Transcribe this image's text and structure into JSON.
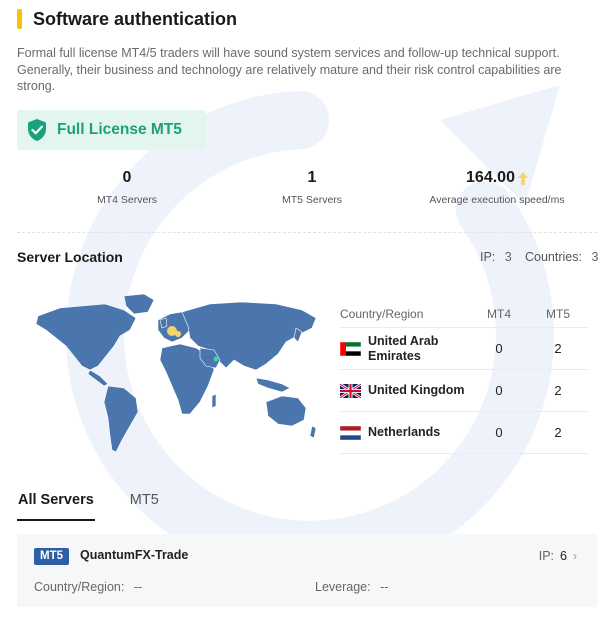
{
  "header": {
    "title": "Software authentication"
  },
  "description": "Formal full license MT4/5 traders will have sound system services and follow-up technical support. Generally, their business and technology are relatively mature and their risk control capabilities are strong.",
  "license": {
    "label": "Full License MT5",
    "icon": "shield-check-icon",
    "color": "#19a27d"
  },
  "stats": {
    "mt4_servers": {
      "value": "0",
      "label": "MT4 Servers"
    },
    "mt5_servers": {
      "value": "1",
      "label": "MT5 Servers"
    },
    "exec_speed": {
      "value": "164.00",
      "label": "Average execution speed/ms",
      "trend_icon": "arrow-up-icon"
    }
  },
  "server_location": {
    "title": "Server Location",
    "ip_label": "IP:",
    "ip_value": "3",
    "countries_label": "Countries:",
    "countries_value": "3",
    "table": {
      "headers": {
        "country": "Country/Region",
        "mt4": "MT4",
        "mt5": "MT5"
      },
      "rows": [
        {
          "country": "United Arab Emirates",
          "flag": "uae-flag-icon",
          "mt4": "0",
          "mt5": "2"
        },
        {
          "country": "United Kingdom",
          "flag": "uk-flag-icon",
          "mt4": "0",
          "mt5": "2"
        },
        {
          "country": "Netherlands",
          "flag": "netherlands-flag-icon",
          "mt4": "0",
          "mt5": "2"
        }
      ]
    }
  },
  "tabs": [
    {
      "label": "All Servers",
      "active": true
    },
    {
      "label": "MT5",
      "active": false
    }
  ],
  "servers": [
    {
      "platform": "MT5",
      "name": "QuantumFX-Trade",
      "ip_label": "IP:",
      "ip_value": "6",
      "country_label": "Country/Region:",
      "country_value": "--",
      "leverage_label": "Leverage:",
      "leverage_value": "--"
    }
  ],
  "colors": {
    "accent_yellow": "#f5c400",
    "license_green": "#19a27d",
    "license_bg": "#e3f5ef",
    "map_blue": "#4a76ad",
    "mt5_tag": "#2f5ea8"
  }
}
